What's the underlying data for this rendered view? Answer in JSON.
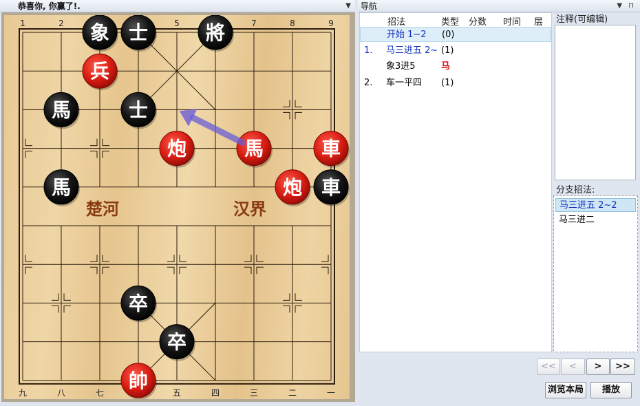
{
  "left_panel": {
    "title": "恭喜你, 你赢了!.",
    "pin": "▼"
  },
  "right_panel": {
    "title": "导航",
    "controls": "▼ ⊓"
  },
  "board": {
    "top_labels": [
      "1",
      "2",
      "3",
      "4",
      "5",
      "6",
      "7",
      "8",
      "9"
    ],
    "bottom_labels": [
      "九",
      "八",
      "七",
      "六",
      "五",
      "四",
      "三",
      "二",
      "一"
    ],
    "river_left": "楚河",
    "river_right": "汉界",
    "pieces": [
      {
        "char": "象",
        "color": "black",
        "col": 2,
        "row": 0
      },
      {
        "char": "士",
        "color": "black",
        "col": 3,
        "row": 0
      },
      {
        "char": "將",
        "color": "black",
        "col": 5,
        "row": 0
      },
      {
        "char": "兵",
        "color": "red",
        "col": 2,
        "row": 1
      },
      {
        "char": "馬",
        "color": "black",
        "col": 1,
        "row": 2
      },
      {
        "char": "士",
        "color": "black",
        "col": 3,
        "row": 2
      },
      {
        "char": "炮",
        "color": "red",
        "col": 4,
        "row": 3
      },
      {
        "char": "馬",
        "color": "red",
        "col": 6,
        "row": 3
      },
      {
        "char": "車",
        "color": "red",
        "col": 8,
        "row": 3
      },
      {
        "char": "馬",
        "color": "black",
        "col": 1,
        "row": 4
      },
      {
        "char": "炮",
        "color": "red",
        "col": 7,
        "row": 4
      },
      {
        "char": "車",
        "color": "black",
        "col": 8,
        "row": 4
      },
      {
        "char": "卒",
        "color": "black",
        "col": 3,
        "row": 7
      },
      {
        "char": "卒",
        "color": "black",
        "col": 4,
        "row": 8
      },
      {
        "char": "帥",
        "color": "red",
        "col": 3,
        "row": 9
      }
    ],
    "arrow": {
      "from": {
        "col": 6,
        "row": 3
      },
      "to": {
        "col": 4,
        "row": 2
      },
      "color": "#6a5ed6"
    }
  },
  "nav": {
    "headers": [
      "招法",
      "类型",
      "分数",
      "时间",
      "层"
    ],
    "rows": [
      {
        "num": "",
        "move": "开始 1~2",
        "type": "(0)",
        "selected": true
      },
      {
        "num": "1.",
        "move": "马三进五 2~",
        "type": "(1)"
      },
      {
        "num": "",
        "move": "象3进5",
        "type": "马"
      },
      {
        "num": "2.",
        "move": "车一平四",
        "type": "(1)"
      }
    ]
  },
  "notes": {
    "label": "注释(可编辑)"
  },
  "branches": {
    "label": "分支招法:",
    "items": [
      "马三进五 2~2",
      "马三进二"
    ]
  },
  "buttons": {
    "first": "<<",
    "prev": "<",
    "next": ">",
    "last": ">>",
    "browse": "浏览本局",
    "play": "播放"
  }
}
